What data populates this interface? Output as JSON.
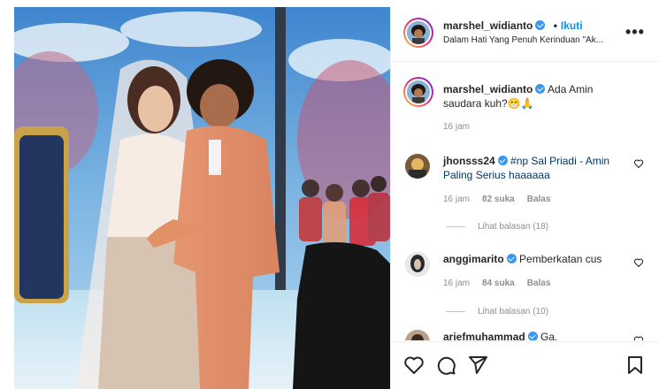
{
  "post": {
    "author": "marshel_widianto",
    "follow_label": "Ikuti",
    "dot": "•",
    "audio": "Dalam Hati Yang Penuh Kerinduan \"Ak..."
  },
  "caption": {
    "username": "marshel_widianto",
    "text": "Ada Amin saudara kuh?😁🙏",
    "time": "16 jam"
  },
  "comments": [
    {
      "username": "jhonsss24",
      "text": "#np Sal Priadi - Amin Paling Serius haaaaaa",
      "time": "16 jam",
      "likes": "82 suka",
      "reply": "Balas",
      "view_replies": "Lihat balasan (18)"
    },
    {
      "username": "anggimarito",
      "text": "Pemberkatan cus",
      "time": "16 jam",
      "likes": "84 suka",
      "reply": "Balas",
      "view_replies": "Lihat balasan (10)"
    },
    {
      "username": "ariefmuhammad",
      "text": "Ga."
    }
  ],
  "more_label": "•••",
  "icons": {
    "like": "heart-icon",
    "comment": "comment-icon",
    "share": "share-icon",
    "save": "bookmark-icon",
    "more": "more-options-icon"
  },
  "colors": {
    "link": "#0095f6",
    "verified": "#3897f0",
    "secondary_text": "#8e8e8e",
    "primary_text": "#262626"
  }
}
